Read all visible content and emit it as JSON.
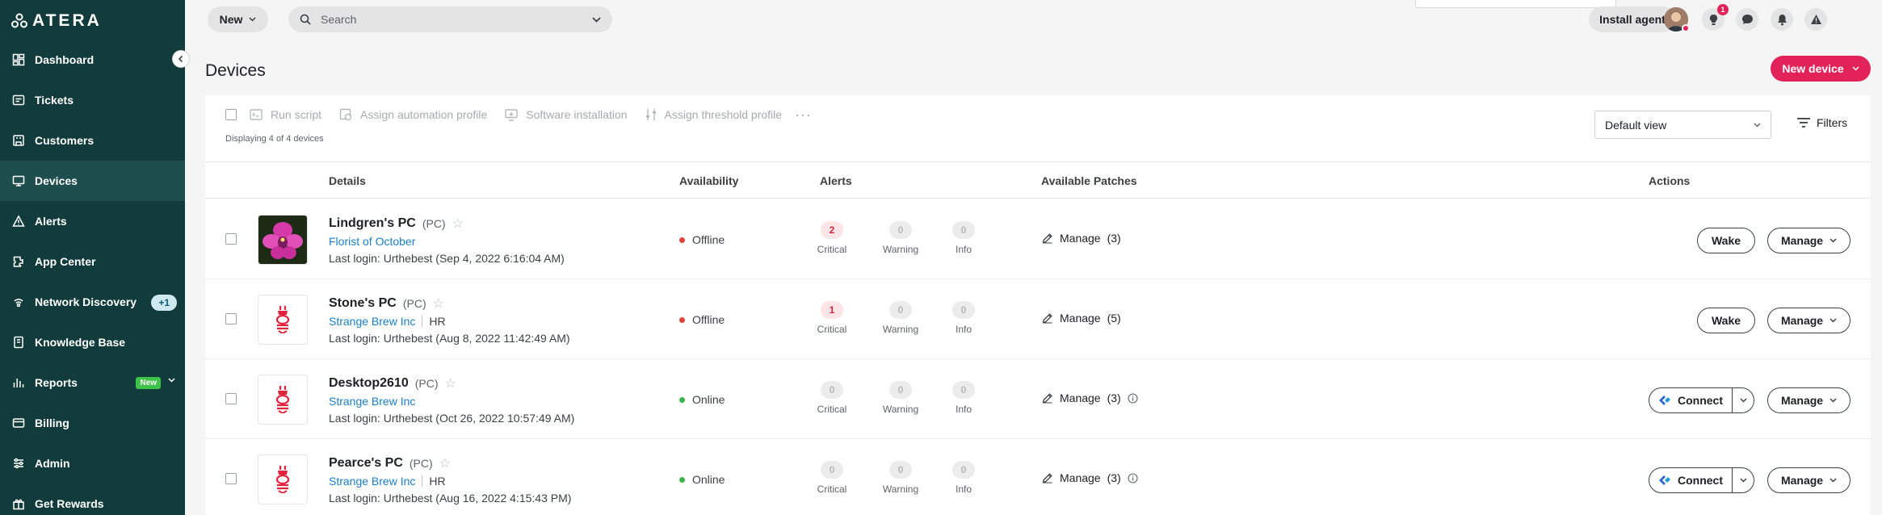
{
  "app": {
    "logo_text": "ATERA"
  },
  "colors": {
    "sidebar_bg": "#123c3c",
    "accent_pink": "#e2235a",
    "link_blue": "#1a7fc4",
    "offline": "#e0433a",
    "online": "#3cb44b"
  },
  "sidebar": {
    "items": [
      {
        "label": "Dashboard",
        "icon": "dashboard-icon"
      },
      {
        "label": "Tickets",
        "icon": "tickets-icon"
      },
      {
        "label": "Customers",
        "icon": "customers-icon"
      },
      {
        "label": "Devices",
        "icon": "devices-icon",
        "active": true
      },
      {
        "label": "Alerts",
        "icon": "alerts-icon"
      },
      {
        "label": "App Center",
        "icon": "app-center-icon"
      },
      {
        "label": "Network Discovery",
        "icon": "network-icon",
        "badge": "+1"
      },
      {
        "label": "Knowledge Base",
        "icon": "knowledge-base-icon"
      },
      {
        "label": "Reports",
        "icon": "reports-icon",
        "tag": "New"
      },
      {
        "label": "Billing",
        "icon": "billing-icon"
      },
      {
        "label": "Admin",
        "icon": "admin-icon"
      },
      {
        "label": "Get Rewards",
        "icon": "rewards-icon"
      }
    ]
  },
  "topbar": {
    "new_label": "New",
    "search_placeholder": "Search",
    "install_agent_label": "Install agent",
    "tips_badge": "1"
  },
  "page": {
    "title": "Devices",
    "new_device_label": "New device"
  },
  "toolbar": {
    "actions": [
      {
        "label": "Run script",
        "icon": "script-icon"
      },
      {
        "label": "Assign automation profile",
        "icon": "automation-icon"
      },
      {
        "label": "Software installation",
        "icon": "software-icon"
      },
      {
        "label": "Assign threshold profile",
        "icon": "threshold-icon"
      }
    ],
    "more": "···",
    "displaying": "Displaying 4 of 4 devices",
    "view_select": "Default view",
    "filters_label": "Filters"
  },
  "table": {
    "headers": {
      "details": "Details",
      "availability": "Availability",
      "alerts": "Alerts",
      "patches": "Available Patches",
      "actions": "Actions"
    },
    "alert_labels": [
      "Critical",
      "Warning",
      "Info"
    ],
    "rows": [
      {
        "name": "Lindgren's PC",
        "type": "(PC)",
        "customer": "Florist of October",
        "dept": "",
        "login": "Last login: Urthebest (Sep 4, 2022 6:16:04 AM)",
        "availability": "Offline",
        "status": "offline",
        "thumb": "orchid-image",
        "alerts": {
          "critical": "2",
          "warning": "0",
          "info": "0"
        },
        "patch_label": "Manage",
        "patch_count": "(3)",
        "patch_info": false,
        "primary_action": "Wake",
        "manage_label": "Manage"
      },
      {
        "name": "Stone's PC",
        "type": "(PC)",
        "customer": "Strange Brew Inc",
        "dept": "HR",
        "login": "Last login: Urthebest (Aug 8, 2022 11:42:49 AM)",
        "availability": "Offline",
        "status": "offline",
        "thumb": "brand-logo",
        "alerts": {
          "critical": "1",
          "warning": "0",
          "info": "0"
        },
        "patch_label": "Manage",
        "patch_count": "(5)",
        "patch_info": false,
        "primary_action": "Wake",
        "manage_label": "Manage"
      },
      {
        "name": "Desktop2610",
        "type": "(PC)",
        "customer": "Strange Brew Inc",
        "dept": "",
        "login": "Last login: Urthebest (Oct 26, 2022 10:57:49 AM)",
        "availability": "Online",
        "status": "online",
        "thumb": "brand-logo",
        "alerts": {
          "critical": "0",
          "warning": "0",
          "info": "0"
        },
        "patch_label": "Manage",
        "patch_count": "(3)",
        "patch_info": true,
        "primary_action": "Connect",
        "manage_label": "Manage"
      },
      {
        "name": "Pearce's PC",
        "type": "(PC)",
        "customer": "Strange Brew Inc",
        "dept": "HR",
        "login": "Last login: Urthebest (Aug 16, 2022 4:15:43 PM)",
        "availability": "Online",
        "status": "online",
        "thumb": "brand-logo",
        "alerts": {
          "critical": "0",
          "warning": "0",
          "info": "0"
        },
        "patch_label": "Manage",
        "patch_count": "(3)",
        "patch_info": true,
        "primary_action": "Connect",
        "manage_label": "Manage"
      }
    ]
  }
}
